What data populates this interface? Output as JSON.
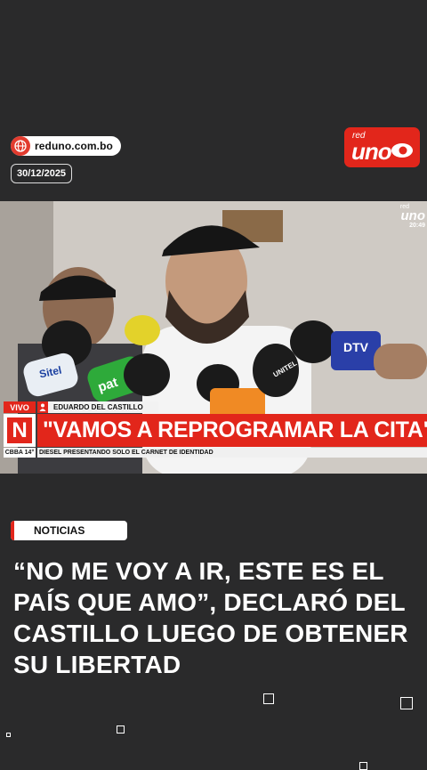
{
  "header": {
    "site_url": "reduno.com.bo",
    "date": "30/12/2025",
    "logo_top": "red",
    "logo_main": "uno"
  },
  "video": {
    "watermark_top": "red",
    "watermark_main": "uno",
    "clock": "20:49",
    "live_label": "VIVO",
    "speaker_name": "EDUARDO DEL CASTILLO",
    "headline": "\"VAMOS A REPROGRAMAR LA CITA\"",
    "channel_letter": "N",
    "weather": "CBBA 14°",
    "ticker": "DIESEL PRESENTANDO SOLO EL CARNET DE IDENTIDAD",
    "mic_labels": [
      "Sitel",
      "pat",
      "UNITEL",
      "DTV"
    ]
  },
  "article": {
    "category": "NOTICIAS",
    "title": "“NO ME VOY A IR, ESTE ES EL PAÍS QUE AMO”, DECLARÓ DEL CASTILLO LUEGO DE OBTENER SU LIBERTAD"
  },
  "colors": {
    "brand_red": "#e2261b",
    "background": "#2a2a2b"
  }
}
